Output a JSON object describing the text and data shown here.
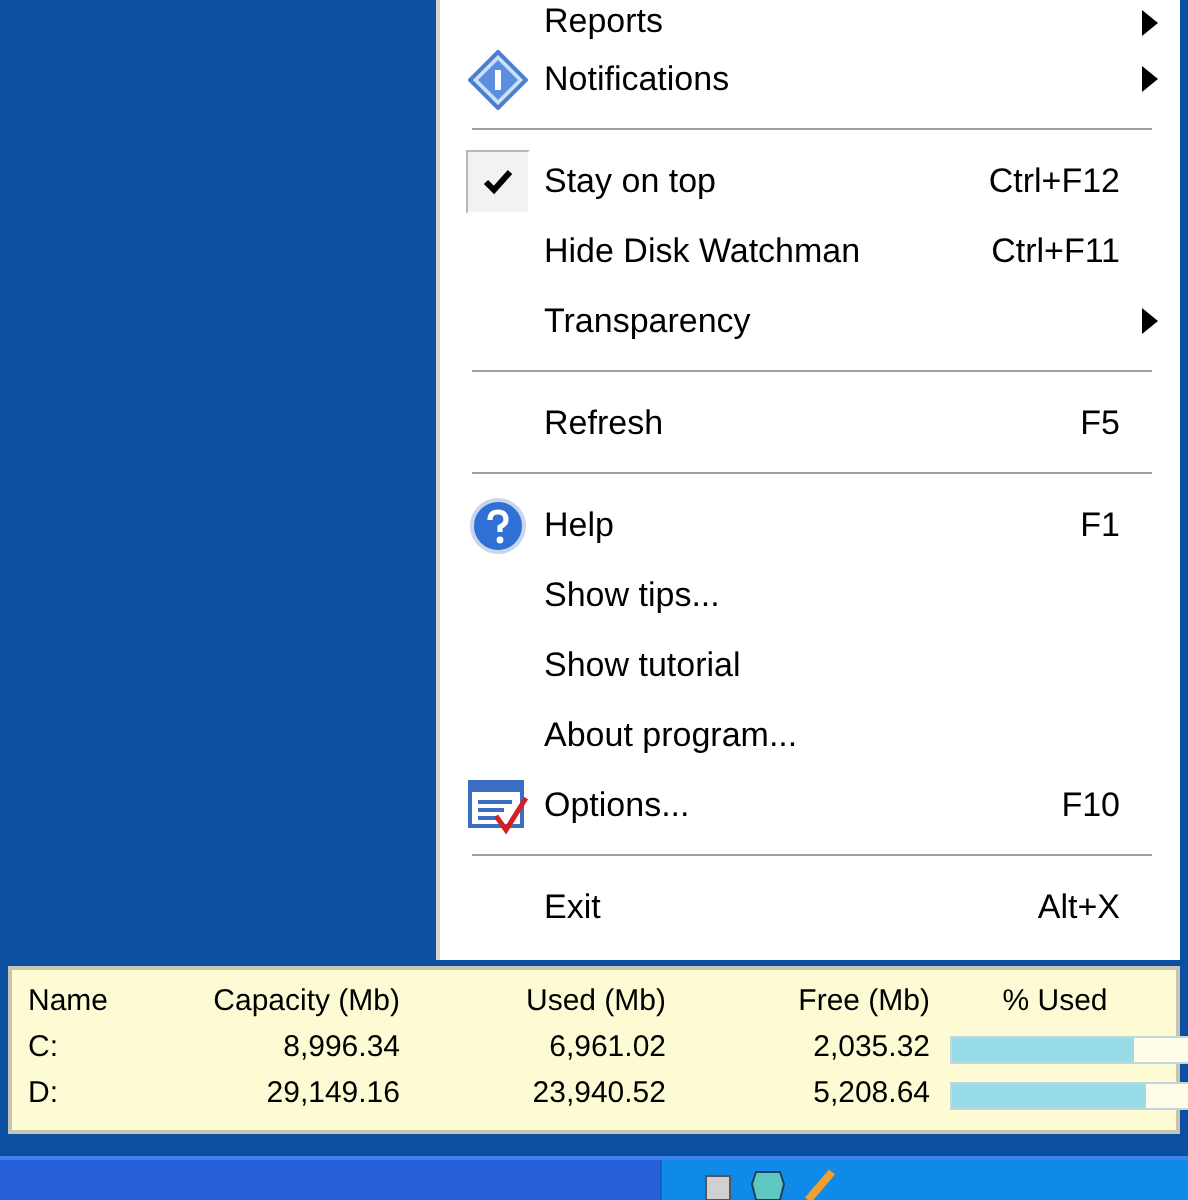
{
  "menu": {
    "items": [
      {
        "kind": "plain",
        "label": "Reports",
        "submenu": true,
        "checked": false
      },
      {
        "kind": "info",
        "label": "Notifications",
        "submenu": true,
        "checked": false
      },
      {
        "kind": "separator"
      },
      {
        "kind": "plain",
        "label": "Stay on top",
        "shortcut": "Ctrl+F12",
        "submenu": false,
        "checked": true
      },
      {
        "kind": "plain",
        "label": "Hide Disk Watchman",
        "shortcut": "Ctrl+F11",
        "submenu": false,
        "checked": false
      },
      {
        "kind": "plain",
        "label": "Transparency",
        "submenu": true,
        "checked": false
      },
      {
        "kind": "separator"
      },
      {
        "kind": "plain",
        "label": "Refresh",
        "shortcut": "F5",
        "submenu": false,
        "checked": false
      },
      {
        "kind": "separator"
      },
      {
        "kind": "help",
        "label": "Help",
        "shortcut": "F1",
        "submenu": false,
        "checked": false
      },
      {
        "kind": "plain",
        "label": "Show tips...",
        "submenu": false,
        "checked": false
      },
      {
        "kind": "plain",
        "label": "Show tutorial",
        "submenu": false,
        "checked": false
      },
      {
        "kind": "plain",
        "label": "About program...",
        "submenu": false,
        "checked": false
      },
      {
        "kind": "options",
        "label": "Options...",
        "shortcut": "F10",
        "submenu": false,
        "checked": false
      },
      {
        "kind": "separator"
      },
      {
        "kind": "plain",
        "label": "Exit",
        "shortcut": "Alt+X",
        "submenu": false,
        "checked": false
      }
    ]
  },
  "disk_panel": {
    "columns": [
      "Name",
      "Capacity (Mb)",
      "Used (Mb)",
      "Free (Mb)",
      "% Used"
    ],
    "rows": [
      {
        "name": "C:",
        "capacity": "8,996.34",
        "used": "6,961.02",
        "free": "2,035.32",
        "level": 0.774
      },
      {
        "name": "D:",
        "capacity": "29,149.16",
        "used": "23,940.52",
        "free": "5,208.64",
        "level": 0.821
      }
    ]
  }
}
